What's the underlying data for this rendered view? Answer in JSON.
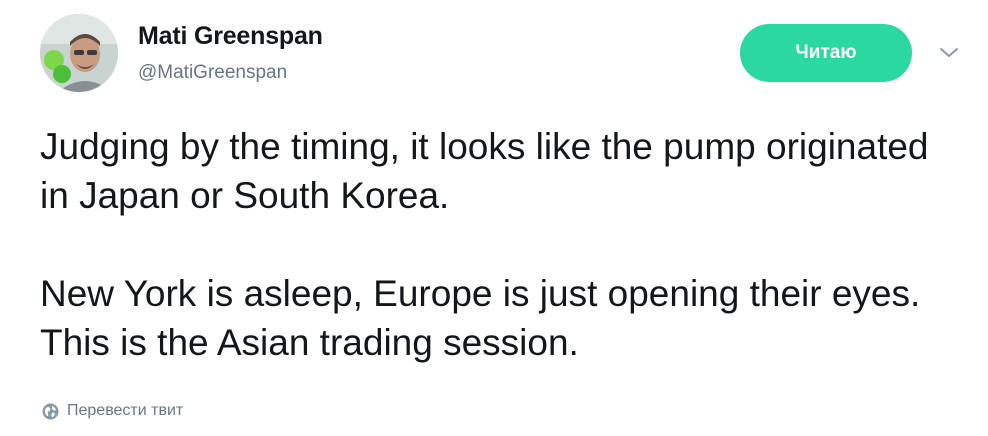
{
  "author": {
    "name": "Mati Greenspan",
    "handle": "@MatiGreenspan"
  },
  "follow_button": {
    "label": "Читаю",
    "color": "#2bd8a0"
  },
  "menu": {
    "icon": "chevron-down-icon"
  },
  "tweet": {
    "paragraphs": [
      "Judging by the timing, it looks like the pump originated in Japan or South Korea.",
      "New York is asleep, Europe is just opening their eyes. This is the Asian trading session."
    ]
  },
  "translate": {
    "label": "Перевести твит",
    "icon": "globe-icon"
  }
}
